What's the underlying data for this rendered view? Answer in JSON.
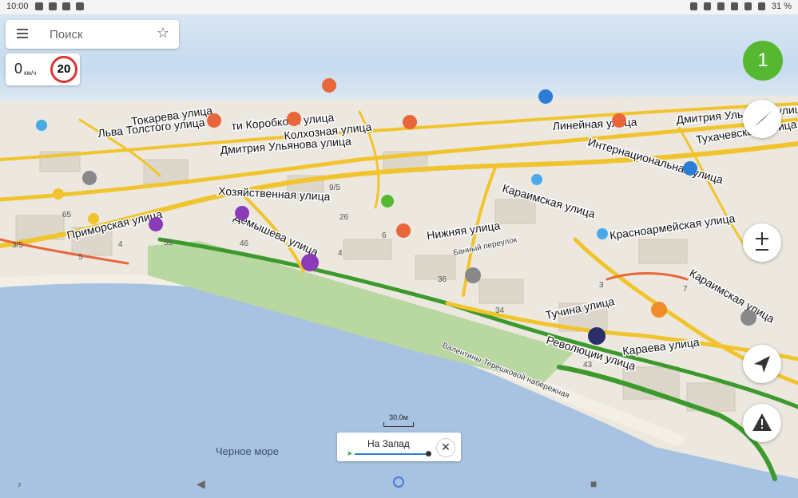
{
  "status_bar": {
    "time": "10:00",
    "battery": "31 %"
  },
  "search": {
    "placeholder": "Поиск"
  },
  "speed": {
    "value": "0",
    "unit": "км/ч",
    "limit": "20"
  },
  "gps_badge": "1",
  "streets": [
    "Токарева улица",
    "Льва Толстого улица",
    "ти Коробкова улица",
    "Колхозная улица",
    "Дмитрия Ульянова улица",
    "Хозяйственная улица",
    "Приморская улица",
    "Демышева улица",
    "Нижняя улица",
    "Банный переулок",
    "Караимская улица",
    "Красноармейская улица",
    "Линейная улица",
    "Интернациональная улица",
    "Дмитрия Ульянова улица",
    "Тухачевского улица",
    "Караимская улица",
    "Тучина улица",
    "Революции улица",
    "Караева улица",
    "Валентины Терешковой набережная"
  ],
  "house_numbers": [
    "3/5",
    "4",
    "5",
    "55",
    "65",
    "46",
    "4",
    "26",
    "36",
    "34",
    "43",
    "6",
    "9/5",
    "3",
    "7"
  ],
  "scale": "30.0м",
  "route": {
    "label": "На Запад",
    "close": "✕"
  },
  "sea_label": "Черное море",
  "colors": {
    "water": "#a7c3e1",
    "park": "#b9d7a0",
    "road_major": "#f1c42d",
    "road_traffic": "#3c9a2d",
    "gps": "#55b830"
  }
}
